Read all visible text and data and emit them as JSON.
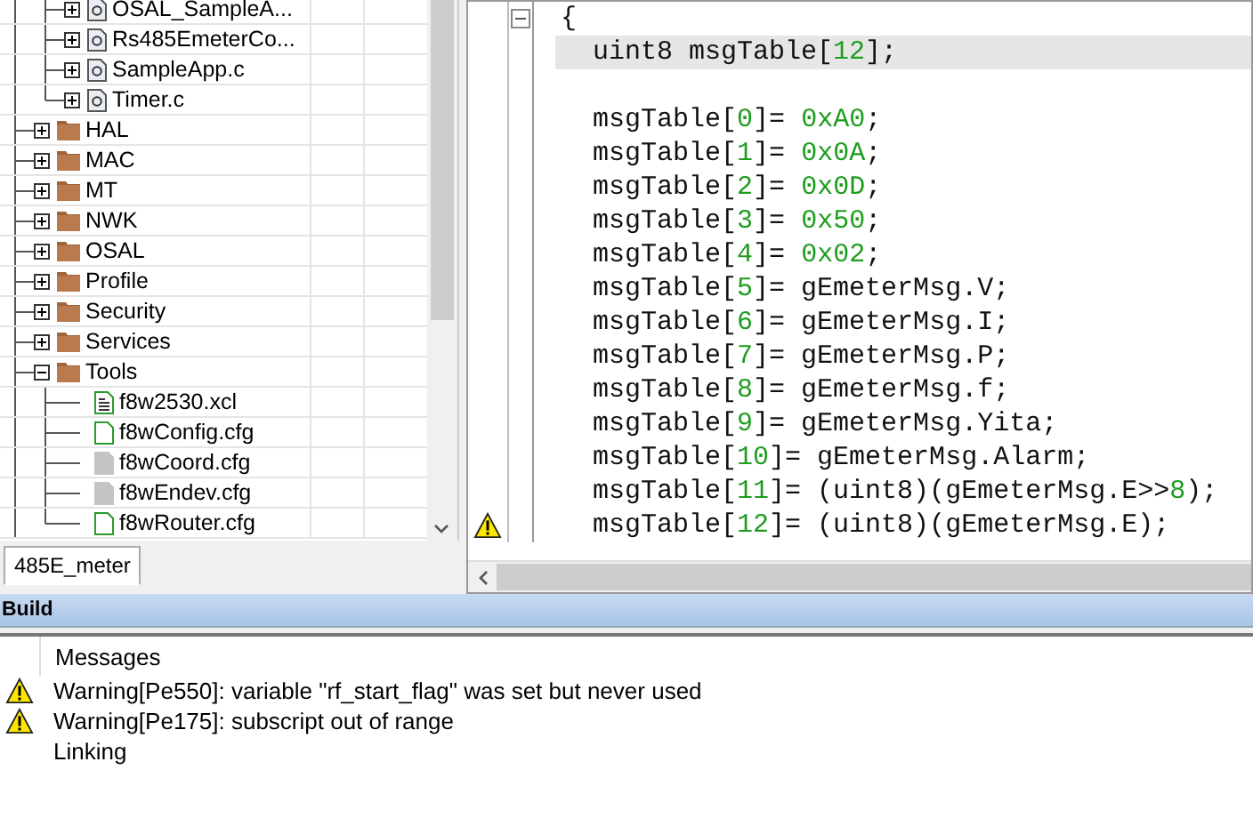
{
  "workspace": {
    "tree": {
      "continued_items": [
        {
          "label": "OSAL_SampleA...",
          "kind": "c_file",
          "expanded": false
        },
        {
          "label": "Rs485EmeterCo...",
          "kind": "c_file",
          "expanded": false
        },
        {
          "label": "SampleApp.c",
          "kind": "c_file",
          "expanded": false
        },
        {
          "label": "Timer.c",
          "kind": "c_file",
          "expanded": false
        }
      ],
      "items": [
        {
          "label": "HAL",
          "kind": "folder",
          "expanded": false
        },
        {
          "label": "MAC",
          "kind": "folder",
          "expanded": false
        },
        {
          "label": "MT",
          "kind": "folder",
          "expanded": false
        },
        {
          "label": "NWK",
          "kind": "folder",
          "expanded": false
        },
        {
          "label": "OSAL",
          "kind": "folder",
          "expanded": false
        },
        {
          "label": "Profile",
          "kind": "folder",
          "expanded": false
        },
        {
          "label": "Security",
          "kind": "folder",
          "expanded": false
        },
        {
          "label": "Services",
          "kind": "folder",
          "expanded": false
        },
        {
          "label": "Tools",
          "kind": "folder",
          "expanded": true,
          "children": [
            {
              "label": "f8w2530.xcl",
              "kind": "text_file"
            },
            {
              "label": "f8wConfig.cfg",
              "kind": "config"
            },
            {
              "label": "f8wCoord.cfg",
              "kind": "excluded"
            },
            {
              "label": "f8wEndev.cfg",
              "kind": "excluded"
            },
            {
              "label": "f8wRouter.cfg",
              "kind": "config"
            }
          ]
        }
      ]
    },
    "tabs": [
      {
        "label": "485E_meter",
        "selected": true
      }
    ]
  },
  "editor": {
    "lines": [
      {
        "fold": true,
        "current": false,
        "warning": false,
        "segments": [
          {
            "kind": "plain",
            "text": "{"
          }
        ]
      },
      {
        "fold": false,
        "current": true,
        "warning": false,
        "segments": [
          {
            "kind": "plain",
            "text": "  uint8 msgTable["
          },
          {
            "kind": "number",
            "text": "12"
          },
          {
            "kind": "plain",
            "text": "];"
          }
        ]
      },
      {
        "fold": false,
        "current": false,
        "warning": false
      },
      {
        "fold": false,
        "current": false,
        "warning": false,
        "segments": [
          {
            "kind": "plain",
            "text": "  msgTable["
          },
          {
            "kind": "number",
            "text": "0"
          },
          {
            "kind": "plain",
            "text": "]= "
          },
          {
            "kind": "number",
            "text": "0xA0"
          },
          {
            "kind": "plain",
            "text": ";"
          }
        ]
      },
      {
        "fold": false,
        "current": false,
        "warning": false,
        "segments": [
          {
            "kind": "plain",
            "text": "  msgTable["
          },
          {
            "kind": "number",
            "text": "1"
          },
          {
            "kind": "plain",
            "text": "]= "
          },
          {
            "kind": "number",
            "text": "0x0A"
          },
          {
            "kind": "plain",
            "text": ";"
          }
        ]
      },
      {
        "fold": false,
        "current": false,
        "warning": false,
        "segments": [
          {
            "kind": "plain",
            "text": "  msgTable["
          },
          {
            "kind": "number",
            "text": "2"
          },
          {
            "kind": "plain",
            "text": "]= "
          },
          {
            "kind": "number",
            "text": "0x0D"
          },
          {
            "kind": "plain",
            "text": ";"
          }
        ]
      },
      {
        "fold": false,
        "current": false,
        "warning": false,
        "segments": [
          {
            "kind": "plain",
            "text": "  msgTable["
          },
          {
            "kind": "number",
            "text": "3"
          },
          {
            "kind": "plain",
            "text": "]= "
          },
          {
            "kind": "number",
            "text": "0x50"
          },
          {
            "kind": "plain",
            "text": ";"
          }
        ]
      },
      {
        "fold": false,
        "current": false,
        "warning": false,
        "segments": [
          {
            "kind": "plain",
            "text": "  msgTable["
          },
          {
            "kind": "number",
            "text": "4"
          },
          {
            "kind": "plain",
            "text": "]= "
          },
          {
            "kind": "number",
            "text": "0x02"
          },
          {
            "kind": "plain",
            "text": ";"
          }
        ]
      },
      {
        "fold": false,
        "current": false,
        "warning": false,
        "segments": [
          {
            "kind": "plain",
            "text": "  msgTable["
          },
          {
            "kind": "number",
            "text": "5"
          },
          {
            "kind": "plain",
            "text": "]= gEmeterMsg.V;"
          }
        ]
      },
      {
        "fold": false,
        "current": false,
        "warning": false,
        "segments": [
          {
            "kind": "plain",
            "text": "  msgTable["
          },
          {
            "kind": "number",
            "text": "6"
          },
          {
            "kind": "plain",
            "text": "]= gEmeterMsg.I;"
          }
        ]
      },
      {
        "fold": false,
        "current": false,
        "warning": false,
        "segments": [
          {
            "kind": "plain",
            "text": "  msgTable["
          },
          {
            "kind": "number",
            "text": "7"
          },
          {
            "kind": "plain",
            "text": "]= gEmeterMsg.P;"
          }
        ]
      },
      {
        "fold": false,
        "current": false,
        "warning": false,
        "segments": [
          {
            "kind": "plain",
            "text": "  msgTable["
          },
          {
            "kind": "number",
            "text": "8"
          },
          {
            "kind": "plain",
            "text": "]= gEmeterMsg.f;"
          }
        ]
      },
      {
        "fold": false,
        "current": false,
        "warning": false,
        "segments": [
          {
            "kind": "plain",
            "text": "  msgTable["
          },
          {
            "kind": "number",
            "text": "9"
          },
          {
            "kind": "plain",
            "text": "]= gEmeterMsg.Yita;"
          }
        ]
      },
      {
        "fold": false,
        "current": false,
        "warning": false,
        "segments": [
          {
            "kind": "plain",
            "text": "  msgTable["
          },
          {
            "kind": "number",
            "text": "10"
          },
          {
            "kind": "plain",
            "text": "]= gEmeterMsg.Alarm;"
          }
        ]
      },
      {
        "fold": false,
        "current": false,
        "warning": false,
        "segments": [
          {
            "kind": "plain",
            "text": "  msgTable["
          },
          {
            "kind": "number",
            "text": "11"
          },
          {
            "kind": "plain",
            "text": "]= (uint8)(gEmeterMsg.E>>"
          },
          {
            "kind": "number",
            "text": "8"
          },
          {
            "kind": "plain",
            "text": ");"
          }
        ]
      },
      {
        "fold": false,
        "current": false,
        "warning": true,
        "segments": [
          {
            "kind": "plain",
            "text": "  msgTable["
          },
          {
            "kind": "number",
            "text": "12"
          },
          {
            "kind": "plain",
            "text": "]= (uint8)(gEmeterMsg.E);"
          }
        ]
      }
    ]
  },
  "build": {
    "title": "Build",
    "messages": [
      {
        "kind": "header",
        "text": "Messages"
      },
      {
        "kind": "warning",
        "text": "Warning[Pe550]: variable \"rf_start_flag\" was set but never used"
      },
      {
        "kind": "warning",
        "text": "Warning[Pe175]: subscript out of range"
      },
      {
        "kind": "info",
        "text": "Linking"
      }
    ]
  }
}
